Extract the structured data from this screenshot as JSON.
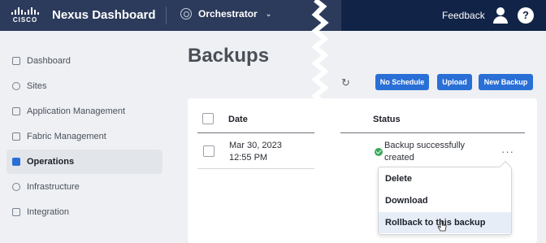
{
  "header": {
    "logo_text": "CISCO",
    "app_title": "Nexus Dashboard",
    "context_label": "Orchestrator",
    "feedback_label": "Feedback",
    "help_symbol": "?"
  },
  "sidebar": {
    "items": [
      {
        "label": "Dashboard",
        "icon": "dashboard-icon",
        "active": false
      },
      {
        "label": "Sites",
        "icon": "globe-icon",
        "active": false
      },
      {
        "label": "Application Management",
        "icon": "app-icon",
        "active": false
      },
      {
        "label": "Fabric Management",
        "icon": "fabric-icon",
        "active": false
      },
      {
        "label": "Operations",
        "icon": "operations-icon",
        "active": true
      },
      {
        "label": "Infrastructure",
        "icon": "refresh-icon",
        "active": false
      },
      {
        "label": "Integration",
        "icon": "integration-icon",
        "active": false
      }
    ]
  },
  "page": {
    "title": "Backups",
    "buttons": {
      "no_schedule": "No Schedule",
      "upload": "Upload",
      "new_backup": "New Backup"
    }
  },
  "table": {
    "columns": [
      "Date",
      "Status"
    ],
    "rows": [
      {
        "date_line1": "Mar 30, 2023",
        "date_line2": "12:55 PM",
        "status_line1": "Backup successfully",
        "status_line2": "created",
        "status_color": "#3aa95b"
      }
    ],
    "row_actions": "···"
  },
  "menu": {
    "items": [
      "Delete",
      "Download",
      "Rollback to this backup"
    ],
    "highlighted": "Rollback to this backup"
  },
  "colors": {
    "header_left": "#2c3b5b",
    "header_right": "#112447",
    "accent": "#2a6fd6",
    "success": "#3aa95b"
  }
}
